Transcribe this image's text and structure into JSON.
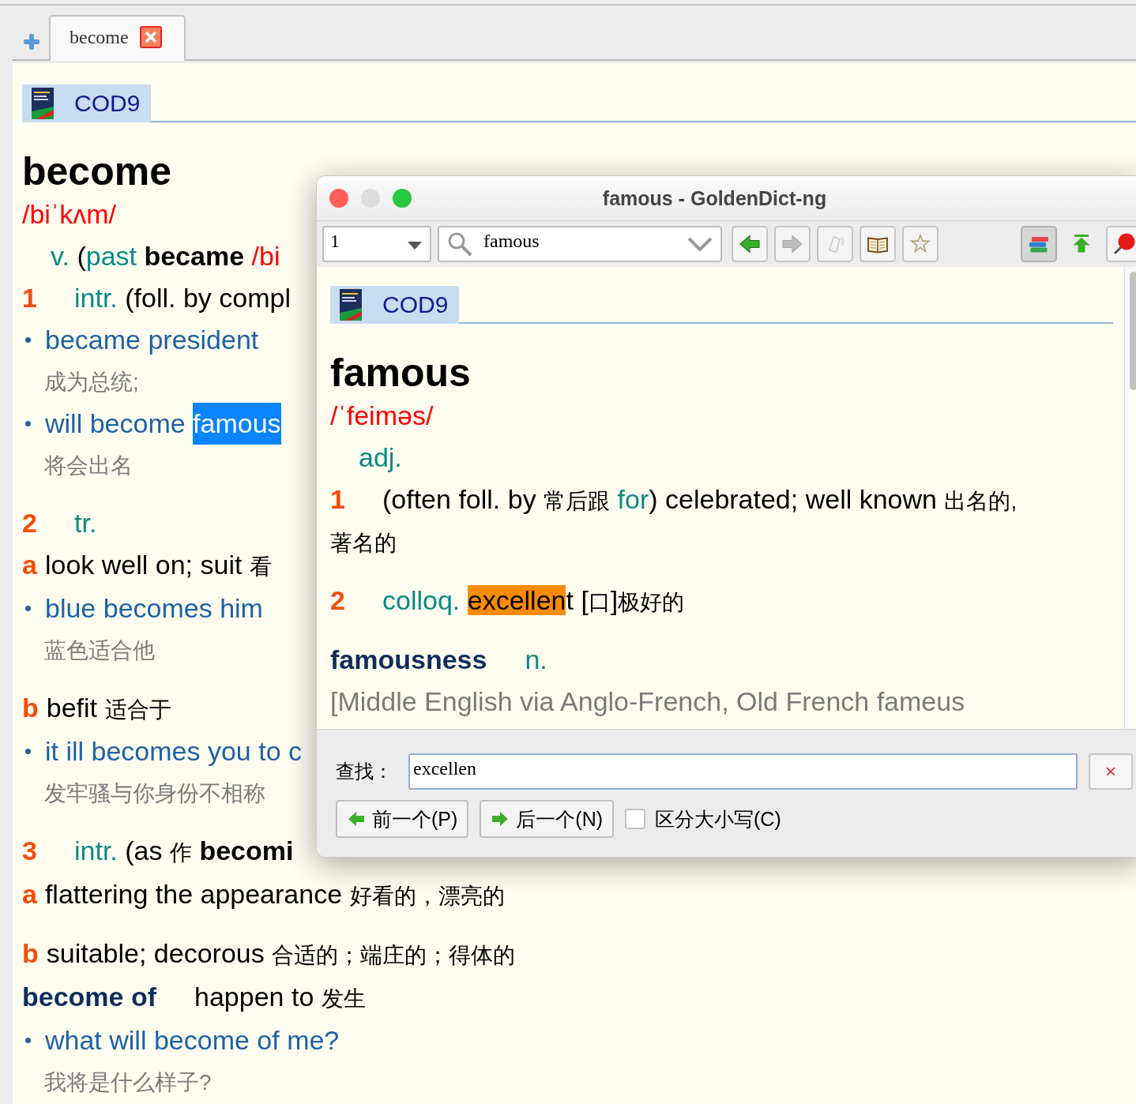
{
  "tabs": [
    {
      "label": "become",
      "selected": true
    }
  ],
  "article": {
    "dictionary": "COD9",
    "lines": [
      {
        "kind": "head",
        "segments": [
          {
            "kind": "head",
            "text": "become"
          }
        ]
      },
      {
        "kind": "plain",
        "segments": [
          {
            "kind": "phon",
            "text": "/biˈkʌm/"
          }
        ]
      },
      {
        "kind": "indent",
        "segments": [
          {
            "kind": "pos",
            "text": "v."
          },
          {
            "kind": "text",
            "text": " ("
          },
          {
            "kind": "pos",
            "text": "past"
          },
          {
            "kind": "bold",
            "text": " became"
          },
          {
            "kind": "phon",
            "text": " /bi"
          }
        ]
      },
      {
        "kind": "sense",
        "segments": [
          {
            "kind": "num",
            "text": "1"
          },
          {
            "kind": "pos",
            "text": "intr."
          },
          {
            "kind": "text",
            "text": " (foll. by compl"
          }
        ]
      },
      {
        "kind": "example",
        "segments": [
          {
            "kind": "ex",
            "text": "became president"
          }
        ]
      },
      {
        "kind": "translation",
        "segments": [
          {
            "kind": "tr",
            "text": "成为总统;"
          }
        ]
      },
      {
        "kind": "example",
        "segments": [
          {
            "kind": "ex",
            "text": "will become "
          },
          {
            "kind": "sel",
            "text": "famous"
          }
        ]
      },
      {
        "kind": "translation",
        "segments": [
          {
            "kind": "tr",
            "text": "将会出名"
          }
        ]
      },
      {
        "kind": "sense",
        "segments": [
          {
            "kind": "num",
            "text": "2"
          },
          {
            "kind": "pos",
            "text": "tr."
          }
        ]
      },
      {
        "kind": "sub",
        "segments": [
          {
            "kind": "letter",
            "text": "a"
          },
          {
            "kind": "text",
            "text": "look well on; suit "
          },
          {
            "kind": "cn",
            "text": "看"
          }
        ]
      },
      {
        "kind": "example",
        "segments": [
          {
            "kind": "ex",
            "text": "blue becomes him"
          }
        ]
      },
      {
        "kind": "translation",
        "segments": [
          {
            "kind": "tr",
            "text": "蓝色适合他"
          }
        ]
      },
      {
        "kind": "sub",
        "segments": [
          {
            "kind": "letter",
            "text": "b"
          },
          {
            "kind": "text",
            "text": "befit "
          },
          {
            "kind": "cn",
            "text": "适合于"
          }
        ]
      },
      {
        "kind": "example",
        "segments": [
          {
            "kind": "ex",
            "text": "it ill becomes you to c"
          }
        ]
      },
      {
        "kind": "translation",
        "segments": [
          {
            "kind": "tr",
            "text": "发牢骚与你身份不相称"
          }
        ]
      },
      {
        "kind": "sense",
        "segments": [
          {
            "kind": "num",
            "text": "3"
          },
          {
            "kind": "pos",
            "text": "intr."
          },
          {
            "kind": "text",
            "text": " (as "
          },
          {
            "kind": "cn",
            "text": "作"
          },
          {
            "kind": "bold",
            "text": " becomi"
          }
        ]
      },
      {
        "kind": "sub",
        "segments": [
          {
            "kind": "letter",
            "text": "a"
          },
          {
            "kind": "text",
            "text": "flattering the appearance "
          },
          {
            "kind": "cn",
            "text": "好看的，漂亮的"
          }
        ]
      },
      {
        "kind": "sub",
        "segments": [
          {
            "kind": "letter",
            "text": "b"
          },
          {
            "kind": "text",
            "text": "suitable; decorous "
          },
          {
            "kind": "cn",
            "text": "合适的；端庄的；得体的"
          }
        ]
      },
      {
        "kind": "phrase",
        "segments": [
          {
            "kind": "phrase",
            "text": "become of"
          },
          {
            "kind": "text",
            "text": "happen to "
          },
          {
            "kind": "cn",
            "text": "发生"
          }
        ]
      },
      {
        "kind": "example",
        "segments": [
          {
            "kind": "ex",
            "text": "what will become of me?"
          }
        ]
      },
      {
        "kind": "translation",
        "segments": [
          {
            "kind": "tr",
            "text": "我将是什么样子?"
          }
        ]
      }
    ]
  },
  "popup": {
    "title": "famous - GoldenDict-ng",
    "group": "1",
    "search": "famous",
    "toolbar": [
      {
        "kind": "back",
        "disabled": false,
        "pressed": false
      },
      {
        "kind": "forward",
        "disabled": true,
        "pressed": false
      },
      {
        "kind": "pronounce",
        "disabled": true,
        "pressed": false
      },
      {
        "kind": "dictionary",
        "disabled": false,
        "pressed": false
      },
      {
        "kind": "favorite",
        "disabled": false,
        "pressed": false
      },
      {
        "kind": "dictionaries",
        "disabled": false,
        "pressed": true
      },
      {
        "kind": "raise",
        "disabled": false,
        "pressed": false
      },
      {
        "kind": "pin",
        "disabled": false,
        "pressed": false
      }
    ],
    "article": {
      "dictionary": "COD9",
      "lines": [
        {
          "kind": "head",
          "segments": [
            {
              "kind": "head",
              "text": "famous"
            }
          ]
        },
        {
          "kind": "plain",
          "segments": [
            {
              "kind": "phon",
              "text": "/ˈfeiməs/"
            }
          ]
        },
        {
          "kind": "indent",
          "segments": [
            {
              "kind": "pos",
              "text": "adj."
            }
          ]
        },
        {
          "kind": "sense",
          "segments": [
            {
              "kind": "num",
              "text": "1"
            },
            {
              "kind": "text",
              "text": "(often foll. by "
            },
            {
              "kind": "cn",
              "text": "常后跟"
            },
            {
              "kind": "pos",
              "text": " for"
            },
            {
              "kind": "text",
              "text": ") celebrated; well known "
            },
            {
              "kind": "cn",
              "text": "出名的,"
            }
          ]
        },
        {
          "kind": "plain",
          "segments": [
            {
              "kind": "cn",
              "text": "著名的"
            }
          ]
        },
        {
          "kind": "sense",
          "segments": [
            {
              "kind": "num",
              "text": "2"
            },
            {
              "kind": "pos",
              "text": "colloq. "
            },
            {
              "kind": "match",
              "text": "excellen"
            },
            {
              "kind": "text",
              "text": "t ["
            },
            {
              "kind": "cn",
              "text": "口"
            },
            {
              "kind": "text",
              "text": "]"
            },
            {
              "kind": "cn",
              "text": "极好的"
            }
          ]
        },
        {
          "kind": "phrase",
          "segments": [
            {
              "kind": "phrase",
              "text": "famousness"
            },
            {
              "kind": "pos",
              "text": "n."
            }
          ]
        },
        {
          "kind": "etym",
          "segments": [
            {
              "kind": "etym",
              "text": "[Middle English via Anglo-French, Old French fameus"
            }
          ]
        }
      ]
    },
    "find": {
      "label": "查找：",
      "value": "excellen",
      "clear": "×",
      "previous": "前一个(P)",
      "next": "后一个(N)",
      "case": {
        "label": "区分大小写(C)",
        "checked": false
      }
    }
  }
}
